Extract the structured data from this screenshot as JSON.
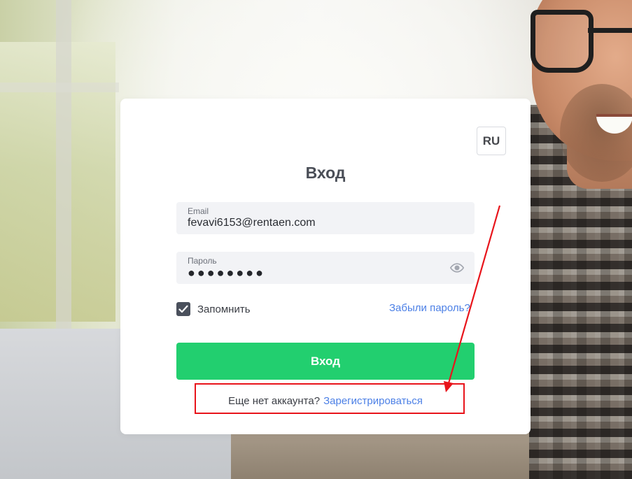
{
  "language": {
    "current": "RU"
  },
  "login": {
    "title": "Вход",
    "email": {
      "label": "Email",
      "value": "fevavi6153@rentaen.com"
    },
    "password": {
      "label": "Пароль",
      "masked_value": "●●●●●●●●"
    },
    "remember": {
      "label": "Запомнить",
      "checked": true
    },
    "forgot_link": "Забыли пароль?",
    "submit_label": "Вход",
    "signup": {
      "prompt": "Еще нет аккаунта?",
      "link": "Зарегистрироваться"
    }
  },
  "icons": {
    "password_toggle": "eye-icon",
    "checkbox_mark": "checkmark-icon"
  },
  "colors": {
    "accent_green": "#22cf6f",
    "link_blue": "#4c80e6",
    "annotation_red": "#e8141b",
    "checkbox_dark": "#4a505c"
  }
}
